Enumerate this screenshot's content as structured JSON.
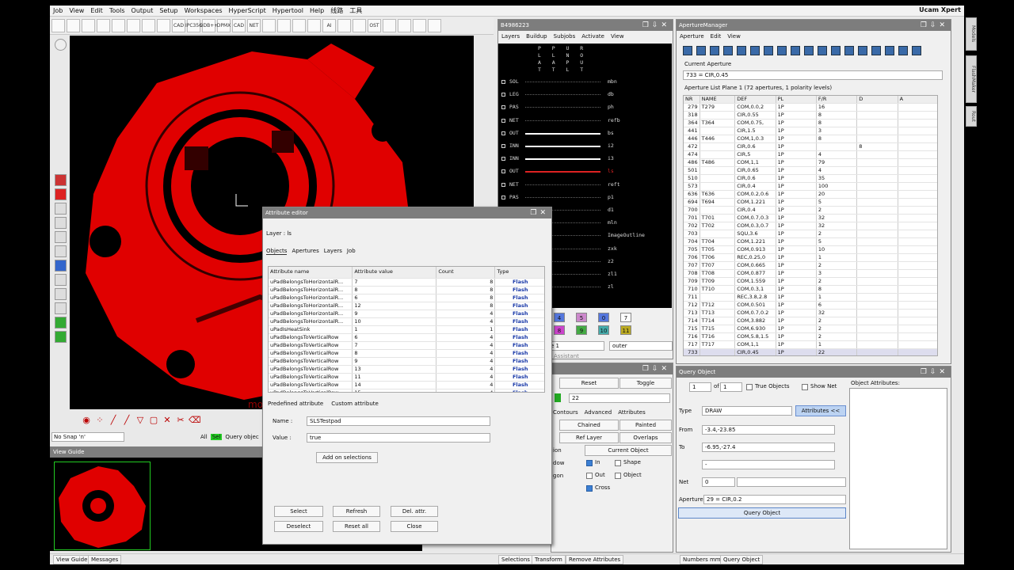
{
  "app": {
    "brand": "Ucam Xpert"
  },
  "menu": [
    "Job",
    "View",
    "Edit",
    "Tools",
    "Output",
    "Setup",
    "Workspaces",
    "HyperScript",
    "Hypertool",
    "Help",
    "线路",
    "工具"
  ],
  "toolbar": {
    "labels": [
      "",
      "",
      "",
      "",
      "",
      "",
      "",
      "",
      "CAD",
      "IPC356",
      "ODB++",
      "DPMX",
      "CAD",
      "NET",
      "",
      "",
      "",
      "",
      "AI",
      "",
      "",
      "OST",
      "",
      "",
      "",
      ""
    ]
  },
  "canvas": {
    "watermark": "mo"
  },
  "snap": {
    "value": "No Snap 'n'",
    "all": "All",
    "sel": "Sel",
    "query": "Query objec"
  },
  "view_guide": {
    "title": "View Guide"
  },
  "status_tabs": [
    "View Guide",
    "Messages",
    "Selections",
    "Transform",
    "Remove Attributes",
    "Numbers mm",
    "Query Object"
  ],
  "layers_panel": {
    "title": "B4986223",
    "menu": [
      "Layers",
      "Buildup",
      "Subjobs",
      "Activate",
      "View"
    ],
    "header": "P  P  U  R\nL  L  N  O\nA  A  P  U\nT  T  L  T",
    "rows": [
      {
        "t": "SOL",
        "n": "mbn"
      },
      {
        "t": "LEG",
        "n": "db"
      },
      {
        "t": "PAS",
        "n": "ph"
      },
      {
        "t": "NET",
        "n": "refb"
      },
      {
        "t": "OUT",
        "n": "bs"
      },
      {
        "t": "INN",
        "n": "i2"
      },
      {
        "t": "INN",
        "n": "i3"
      },
      {
        "t": "OUT",
        "n": "ls"
      },
      {
        "t": "NET",
        "n": "reft"
      },
      {
        "t": "PAS",
        "n": "p1"
      },
      {
        "t": "",
        "n": "d1"
      },
      {
        "t": "",
        "n": "mln"
      },
      {
        "t": "",
        "n": "ImageOutline"
      },
      {
        "t": "",
        "n": "zxk"
      },
      {
        "t": "",
        "n": "z2"
      },
      {
        "t": "",
        "n": "zl1"
      },
      {
        "t": "",
        "n": "zl"
      }
    ],
    "nums": [
      "4",
      "5",
      "0",
      "7",
      "8",
      "9",
      "10",
      "11"
    ],
    "field_left": "e 1",
    "field_right": "outer",
    "assistant": "Assistant"
  },
  "aperture": {
    "title": "ApertureManager",
    "menu": [
      "Aperture",
      "Edit",
      "View"
    ],
    "current_label": "Current Aperture",
    "current_value": "733 = CIR,0.45",
    "list_label": "Aperture List Plane 1 (72 apertures, 1 polarity levels)",
    "cols": [
      "NR",
      "NAME",
      "DEF",
      "PL",
      "F/R",
      "D",
      "A"
    ],
    "rows": [
      [
        "279",
        "T279",
        "COM,0.0,2",
        "1P",
        "16",
        "",
        ""
      ],
      [
        "318",
        "",
        "CIR,0.55",
        "1P",
        "8",
        "",
        ""
      ],
      [
        "364",
        "T364",
        "COM,0.75,",
        "1P",
        "8",
        "",
        ""
      ],
      [
        "441",
        "",
        "CIR,1.5",
        "1P",
        "3",
        "",
        ""
      ],
      [
        "446",
        "T446",
        "COM,1,0.3",
        "1P",
        "8",
        "",
        ""
      ],
      [
        "472",
        "",
        "CIR,0.6",
        "1P",
        "",
        "8",
        ""
      ],
      [
        "474",
        "",
        "CIR,5",
        "1P",
        "4",
        "",
        ""
      ],
      [
        "486",
        "T486",
        "COM,1,1",
        "1P",
        "79",
        "",
        ""
      ],
      [
        "501",
        "",
        "CIR,0.65",
        "1P",
        "4",
        "",
        ""
      ],
      [
        "510",
        "",
        "CIR,0.6",
        "1P",
        "35",
        "",
        ""
      ],
      [
        "573",
        "",
        "CIR,0.4",
        "1P",
        "100",
        "",
        ""
      ],
      [
        "636",
        "T636",
        "COM,0.2,0.6",
        "1P",
        "20",
        "",
        ""
      ],
      [
        "694",
        "T694",
        "COM,1.221",
        "1P",
        "5",
        "",
        ""
      ],
      [
        "700",
        "",
        "CIR,0.4",
        "1P",
        "2",
        "",
        ""
      ],
      [
        "701",
        "T701",
        "COM,0.7,0.3",
        "1P",
        "32",
        "",
        ""
      ],
      [
        "702",
        "T702",
        "COM,0.3,0.7",
        "1P",
        "32",
        "",
        ""
      ],
      [
        "703",
        "",
        "SQU,3.6",
        "1P",
        "2",
        "",
        ""
      ],
      [
        "704",
        "T704",
        "COM,1.221",
        "1P",
        "5",
        "",
        ""
      ],
      [
        "705",
        "T705",
        "COM,0.913",
        "1P",
        "10",
        "",
        ""
      ],
      [
        "706",
        "T706",
        "REC,0.25,0",
        "1P",
        "1",
        "",
        ""
      ],
      [
        "707",
        "T707",
        "COM,0.665",
        "1P",
        "2",
        "",
        ""
      ],
      [
        "708",
        "T708",
        "COM,0.877",
        "1P",
        "3",
        "",
        ""
      ],
      [
        "709",
        "T709",
        "COM,1.559",
        "1P",
        "2",
        "",
        ""
      ],
      [
        "710",
        "T710",
        "COM,0.3,1",
        "1P",
        "8",
        "",
        ""
      ],
      [
        "711",
        "",
        "REC,3.8,2.8",
        "1P",
        "1",
        "",
        ""
      ],
      [
        "712",
        "T712",
        "COM,0.501",
        "1P",
        "6",
        "",
        ""
      ],
      [
        "713",
        "T713",
        "COM,0.7,0.2",
        "1P",
        "32",
        "",
        ""
      ],
      [
        "714",
        "T714",
        "COM,3.882",
        "1P",
        "2",
        "",
        ""
      ],
      [
        "715",
        "T715",
        "COM,6.930",
        "1P",
        "2",
        "",
        ""
      ],
      [
        "716",
        "T716",
        "COM,5.8,1.5",
        "1P",
        "2",
        "",
        ""
      ],
      [
        "717",
        "T717",
        "COM,1,1",
        "1P",
        "1",
        "",
        ""
      ],
      [
        "733",
        "",
        "CIR,0.45",
        "1P",
        "22",
        "",
        ""
      ]
    ]
  },
  "select_panel": {
    "reset": "Reset",
    "toggle": "Toggle",
    "num": "22",
    "tabs": [
      "Contours",
      "Advanced",
      "Attributes"
    ],
    "chained": "Chained",
    "painted": "Painted",
    "ref_layer": "Ref Layer",
    "overlaps": "Overlaps",
    "current_object": "Current Object",
    "ion": "ion",
    "dow": "dow",
    "gon": "gon",
    "in": "In",
    "shape": "Shape",
    "out": "Out",
    "object": "Object",
    "cross": "Cross"
  },
  "query": {
    "title": "Query Object",
    "index": "1",
    "of": "of",
    "total": "1",
    "true_objects": "True Objects",
    "show_net": "Show Net",
    "obj_attr": "Object Attributes:",
    "type_label": "Type",
    "type_value": "DRAW",
    "attr_btn": "Attributes <<",
    "from_label": "From",
    "from_value": "-3.4,-23.85",
    "to_label": "To",
    "to_value": "-6.95,-27.4",
    "dash": "-",
    "net_label": "Net",
    "net_value": "0",
    "ap_label": "Aperture",
    "ap_value": "29 = CIR,0.2",
    "query_btn": "Query Object"
  },
  "attr_editor": {
    "title": "Attribute editor",
    "layer": "Layer : ls",
    "tabs": [
      "Objects",
      "Apertures",
      "Layers",
      "Job"
    ],
    "cols": [
      "Attribute name",
      "Attribute value",
      "Count",
      "Type"
    ],
    "rows": [
      [
        "uPadBelongsToHorizontalR...",
        "7",
        "8",
        "Flash"
      ],
      [
        "uPadBelongsToHorizontalR...",
        "8",
        "8",
        "Flash"
      ],
      [
        "uPadBelongsToHorizontalR...",
        "6",
        "8",
        "Flash"
      ],
      [
        "uPadBelongsToHorizontalR...",
        "12",
        "8",
        "Flash"
      ],
      [
        "uPadBelongsToHorizontalR...",
        "9",
        "4",
        "Flash"
      ],
      [
        "uPadBelongsToHorizontalR...",
        "10",
        "4",
        "Flash"
      ],
      [
        "uPadIsHeatSink",
        "1",
        "1",
        "Flash"
      ],
      [
        "uPadBelongsToVerticalRow",
        "6",
        "4",
        "Flash"
      ],
      [
        "uPadBelongsToVerticalRow",
        "7",
        "4",
        "Flash"
      ],
      [
        "uPadBelongsToVerticalRow",
        "8",
        "4",
        "Flash"
      ],
      [
        "uPadBelongsToVerticalRow",
        "9",
        "4",
        "Flash"
      ],
      [
        "uPadBelongsToVerticalRow",
        "13",
        "4",
        "Flash"
      ],
      [
        "uPadBelongsToVerticalRow",
        "11",
        "4",
        "Flash"
      ],
      [
        "uPadBelongsToVerticalRow",
        "14",
        "4",
        "Flash"
      ],
      [
        "uPadBelongsToVerticalRow",
        "15",
        "4",
        "Flash"
      ]
    ],
    "subtabs": [
      "Predefined attribute",
      "Custom attribute"
    ],
    "name_label": "Name :",
    "name_value": "SLSTestpad",
    "value_label": "Value :",
    "value_value": "true",
    "add_btn": "Add on selections",
    "buttons": [
      "Select",
      "Refresh",
      "Del. attr.",
      "Deselect",
      "Reset all",
      "Close"
    ]
  },
  "side_tabs": [
    "Models",
    "FlashMaker",
    "Rout"
  ]
}
